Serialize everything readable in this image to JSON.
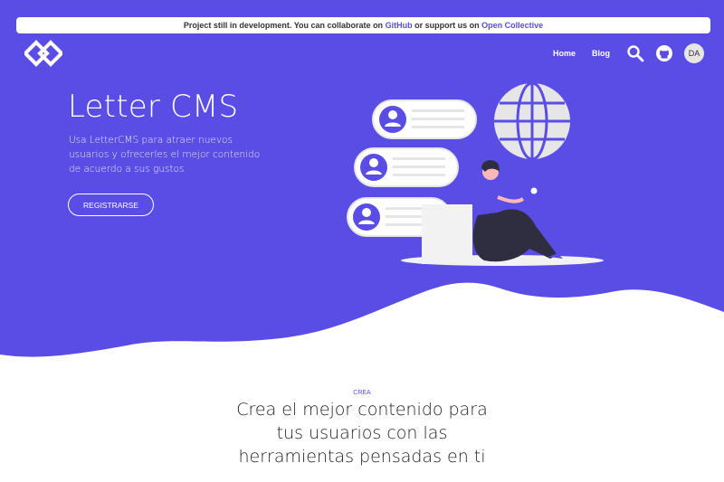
{
  "banner": {
    "prefix": "Project still in development. You can collaborate on",
    "github": "GitHub",
    "middle": "or support us on",
    "opencollective": "Open Collective"
  },
  "nav": {
    "home": "Home",
    "blog": "Blog",
    "avatar_initials": "DA",
    "icons": [
      "search-icon",
      "github-icon"
    ]
  },
  "hero": {
    "title": "Letter CMS",
    "description": "Usa LetterCMS para atraer nuevos usuarios y ofrecerles el mejor contenido de acuerdo a sus gustos",
    "button": "REGISTRARSE"
  },
  "section": {
    "label": "CREA",
    "title": "Crea el mejor contenido para tus usuarios con las herramientas pensadas en ti"
  },
  "colors": {
    "brand": "#5a4de6",
    "white": "#ffffff"
  }
}
